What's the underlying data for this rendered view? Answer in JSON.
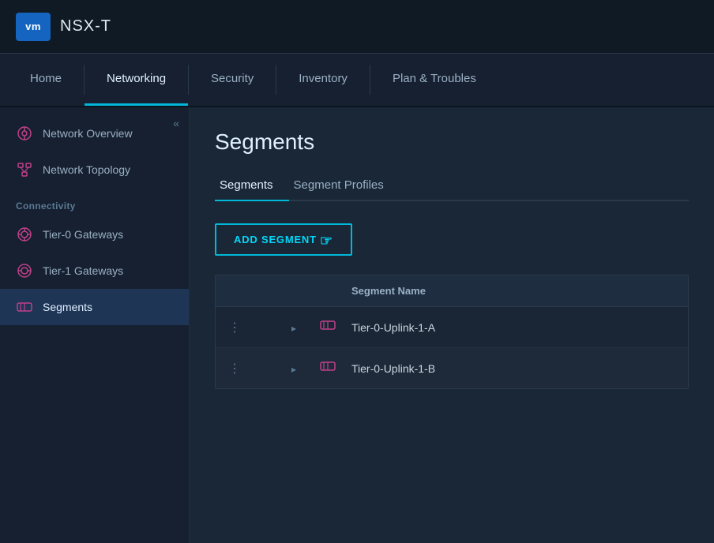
{
  "topbar": {
    "vm_logo": "vm",
    "app_name": "NSX-T"
  },
  "navbar": {
    "items": [
      {
        "id": "home",
        "label": "Home",
        "active": false
      },
      {
        "id": "networking",
        "label": "Networking",
        "active": true
      },
      {
        "id": "security",
        "label": "Security",
        "active": false
      },
      {
        "id": "inventory",
        "label": "Inventory",
        "active": false
      },
      {
        "id": "plan-troubles",
        "label": "Plan & Troubles",
        "active": false
      }
    ]
  },
  "sidebar": {
    "collapse_label": "«",
    "items_top": [
      {
        "id": "network-overview",
        "label": "Network Overview"
      },
      {
        "id": "network-topology",
        "label": "Network Topology"
      }
    ],
    "connectivity_label": "Connectivity",
    "items_connectivity": [
      {
        "id": "tier0-gateways",
        "label": "Tier-0 Gateways"
      },
      {
        "id": "tier1-gateways",
        "label": "Tier-1 Gateways"
      },
      {
        "id": "segments",
        "label": "Segments",
        "active": true
      }
    ]
  },
  "content": {
    "page_title": "Segments",
    "tabs": [
      {
        "id": "segments-tab",
        "label": "Segments",
        "active": true
      },
      {
        "id": "segment-profiles-tab",
        "label": "Segment Profiles",
        "active": false
      }
    ],
    "add_button_label": "ADD SEGMENT",
    "table": {
      "headers": [
        {
          "id": "actions-header",
          "label": "",
          "class": "col-actions"
        },
        {
          "id": "expand-header",
          "label": "",
          "class": "col-expand"
        },
        {
          "id": "icon-header",
          "label": "",
          "class": "col-icon"
        },
        {
          "id": "name-header",
          "label": "Segment Name",
          "class": "col-name"
        }
      ],
      "rows": [
        {
          "id": "row-1",
          "segment_name": "Tier-0-Uplink-1-A"
        },
        {
          "id": "row-2",
          "segment_name": "Tier-0-Uplink-1-B"
        }
      ]
    }
  }
}
